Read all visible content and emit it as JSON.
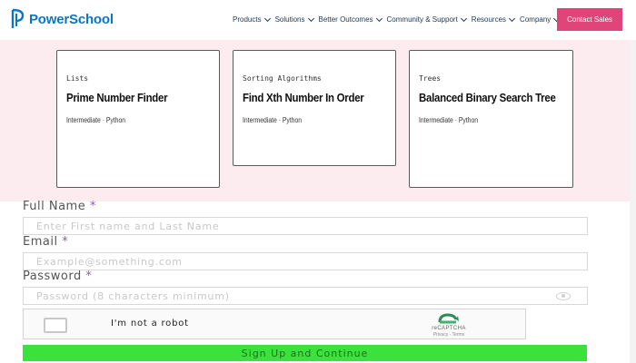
{
  "brand": {
    "name": "PowerSchool",
    "color": "#0b75c6"
  },
  "nav": {
    "items": [
      {
        "label": "Products"
      },
      {
        "label": "Solutions"
      },
      {
        "label": "Better Outcomes"
      },
      {
        "label": "Community & Support"
      },
      {
        "label": "Resources"
      },
      {
        "label": "Company"
      }
    ],
    "cta": "Contact Sales",
    "cta_color": "#e0457a"
  },
  "cards": [
    {
      "category": "Lists",
      "title": "Prime Number Finder",
      "meta": "Intermediate · Python"
    },
    {
      "category": "Sorting Algorithms",
      "title": "Find Xth Number In Order",
      "meta": "Intermediate · Python"
    },
    {
      "category": "Trees",
      "title": "Balanced Binary Search Tree",
      "meta": "Intermediate · Python"
    }
  ],
  "form": {
    "full_name": {
      "label": "Full Name",
      "required": "*",
      "placeholder": "Enter First name and Last Name"
    },
    "email": {
      "label": "Email",
      "required": "*",
      "placeholder": "Example@something.com"
    },
    "password": {
      "label": "Password",
      "required": "*",
      "placeholder": "Password (8 characters minimum)"
    },
    "captcha": {
      "text": "I'm not a robot",
      "brand": "reCAPTCHA",
      "links": "Privacy - Terms"
    },
    "submit": "Sign Up and Continue",
    "submit_color": "#3ce23c"
  },
  "icons": [
    "powerschool-logo-icon",
    "chevron-down-icon",
    "eye-icon",
    "recaptcha-icon"
  ]
}
